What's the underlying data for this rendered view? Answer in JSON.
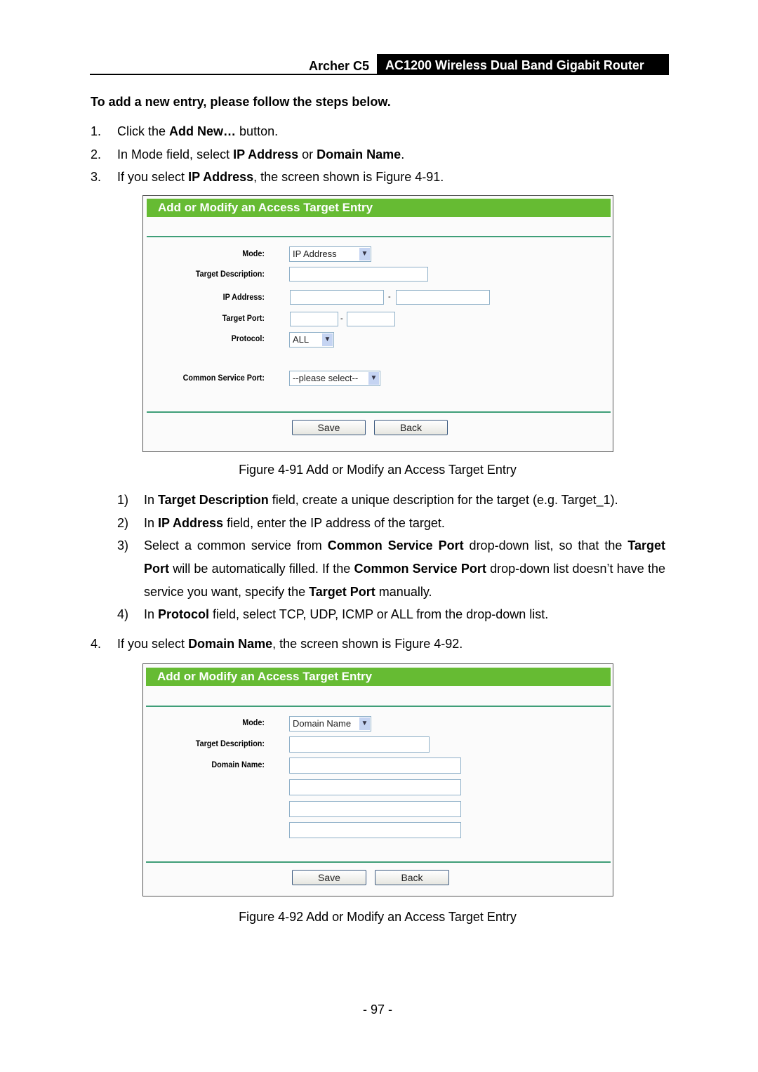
{
  "header": {
    "model": "Archer C5",
    "product": "AC1200 Wireless Dual Band Gigabit Router"
  },
  "intro": "To add a new entry, please follow the steps below.",
  "steps": [
    {
      "num": "1.",
      "segs": [
        {
          "t": "Click the "
        },
        {
          "t": "Add New…",
          "b": true
        },
        {
          "t": " button."
        }
      ]
    },
    {
      "num": "2.",
      "segs": [
        {
          "t": "In Mode field, select "
        },
        {
          "t": "IP Address",
          "b": true
        },
        {
          "t": " or "
        },
        {
          "t": "Domain Name",
          "b": true
        },
        {
          "t": "."
        }
      ]
    },
    {
      "num": "3.",
      "segs": [
        {
          "t": "If you select "
        },
        {
          "t": "IP Address",
          "b": true
        },
        {
          "t": ", the screen shown is Figure 4-91."
        }
      ]
    },
    {
      "num": "4.",
      "segs": [
        {
          "t": "If you select "
        },
        {
          "t": "Domain Name",
          "b": true
        },
        {
          "t": ", the screen shown is Figure 4-92."
        }
      ]
    }
  ],
  "substeps": [
    {
      "num": "1)",
      "segs": [
        {
          "t": "In "
        },
        {
          "t": "Target Description",
          "b": true
        },
        {
          "t": " field, create a unique description for the target (e.g. Target_1)."
        }
      ]
    },
    {
      "num": "2)",
      "segs": [
        {
          "t": "In "
        },
        {
          "t": "IP Address",
          "b": true
        },
        {
          "t": " field, enter the IP address of the target."
        }
      ]
    },
    {
      "num": "3)",
      "segs": [
        {
          "t": "Select a common service from "
        },
        {
          "t": "Common Service Port",
          "b": true
        },
        {
          "t": " drop-down list, so that the "
        },
        {
          "t": "Target Port",
          "b": true
        },
        {
          "t": " will be automatically filled. If the "
        },
        {
          "t": "Common Service Port",
          "b": true
        },
        {
          "t": " drop-down list doesn’t have the service you want, specify the "
        },
        {
          "t": "Target Port",
          "b": true
        },
        {
          "t": " manually."
        }
      ]
    },
    {
      "num": "4)",
      "segs": [
        {
          "t": "In "
        },
        {
          "t": "Protocol",
          "b": true
        },
        {
          "t": " field, select TCP, UDP, ICMP or ALL from the drop-down list."
        }
      ]
    }
  ],
  "figure1": {
    "title": "Add or Modify an Access Target Entry",
    "labels": {
      "mode": "Mode:",
      "desc": "Target Description:",
      "ip": "IP Address:",
      "port": "Target Port:",
      "protocol": "Protocol:",
      "service": "Common Service Port:"
    },
    "mode_value": "IP Address",
    "protocol_value": "ALL",
    "service_value": "--please select--",
    "dash": "-",
    "save": "Save",
    "back": "Back",
    "caption": "Figure 4-91 Add or Modify an Access Target Entry"
  },
  "figure2": {
    "title": "Add or Modify an Access Target Entry",
    "labels": {
      "mode": "Mode:",
      "desc": "Target Description:",
      "domain": "Domain Name:"
    },
    "mode_value": "Domain Name",
    "save": "Save",
    "back": "Back",
    "caption": "Figure 4-92 Add or Modify an Access Target Entry"
  },
  "page_number": "- 97 -",
  "colors": {
    "title_bar": "#66bb33",
    "rule": "#3f9e78"
  }
}
